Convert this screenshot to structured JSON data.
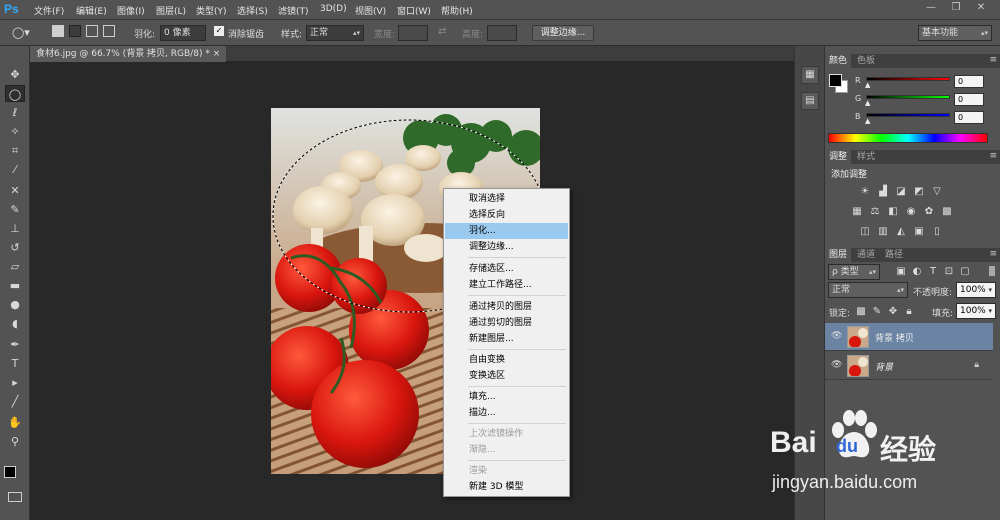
{
  "app": {
    "logo": "Ps"
  },
  "menu": [
    "文件(F)",
    "编辑(E)",
    "图像(I)",
    "图层(L)",
    "类型(Y)",
    "选择(S)",
    "滤镜(T)",
    "3D(D)",
    "视图(V)",
    "窗口(W)",
    "帮助(H)"
  ],
  "window_controls": {
    "minimize": "—",
    "restore": "❐",
    "close": "✕"
  },
  "options": {
    "feather_label": "羽化:",
    "feather_value": "0 像素",
    "antialias_label": "消除锯齿",
    "antialias_checked": true,
    "style_label": "样式:",
    "style_value": "正常",
    "width_label": "宽度:",
    "height_label": "高度:",
    "refine_edge_button": "调整边缘...",
    "workspace": "基本功能"
  },
  "document": {
    "tab_label": "食材6.jpg @ 66.7% (背景 拷贝, RGB/8) *",
    "close": "×"
  },
  "context_menu": {
    "items": [
      {
        "label": "取消选择",
        "state": "normal"
      },
      {
        "label": "选择反向",
        "state": "normal"
      },
      {
        "label": "羽化...",
        "state": "highlighted"
      },
      {
        "label": "调整边缘...",
        "state": "normal"
      },
      {
        "label": "存储选区...",
        "state": "normal"
      },
      {
        "label": "建立工作路径...",
        "state": "normal"
      },
      {
        "label": "通过拷贝的图层",
        "state": "normal"
      },
      {
        "label": "通过剪切的图层",
        "state": "normal"
      },
      {
        "label": "新建图层...",
        "state": "normal"
      },
      {
        "label": "自由变换",
        "state": "normal"
      },
      {
        "label": "变换选区",
        "state": "normal"
      },
      {
        "label": "填充...",
        "state": "normal"
      },
      {
        "label": "描边...",
        "state": "normal"
      },
      {
        "label": "上次滤镜操作",
        "state": "disabled"
      },
      {
        "label": "渐隐...",
        "state": "disabled"
      },
      {
        "label": "渲染",
        "state": "disabled"
      },
      {
        "label": "新建 3D 模型",
        "state": "normal"
      }
    ]
  },
  "color_panel": {
    "tabs": [
      "颜色",
      "色板"
    ],
    "channels": [
      {
        "label": "R",
        "value": "0",
        "color": "#e02020"
      },
      {
        "label": "G",
        "value": "0",
        "color": "#20c020"
      },
      {
        "label": "B",
        "value": "0",
        "color": "#2030e0"
      }
    ]
  },
  "adjust_panel": {
    "tabs": [
      "调整",
      "样式"
    ],
    "title": "添加调整"
  },
  "layers_panel": {
    "tabs": [
      "图层",
      "通道",
      "路径"
    ],
    "filter": "ρ 类型",
    "blend_mode": "正常",
    "opacity_label": "不透明度:",
    "opacity_value": "100%",
    "lock_label": "锁定:",
    "fill_label": "填充:",
    "fill_value": "100%",
    "layers": [
      {
        "name": "背景 拷贝",
        "selected": true,
        "locked": false
      },
      {
        "name": "背景",
        "selected": false,
        "locked": true
      }
    ]
  },
  "watermark": {
    "brand": "Bai",
    "brand2": "du",
    "suffix": "经验",
    "url": "jingyan.baidu.com"
  },
  "colors": {
    "accent_highlight": "#99c9ef",
    "layer_selected": "#6c84a4",
    "panel_bg": "#535353",
    "canvas_bg": "#282828"
  }
}
